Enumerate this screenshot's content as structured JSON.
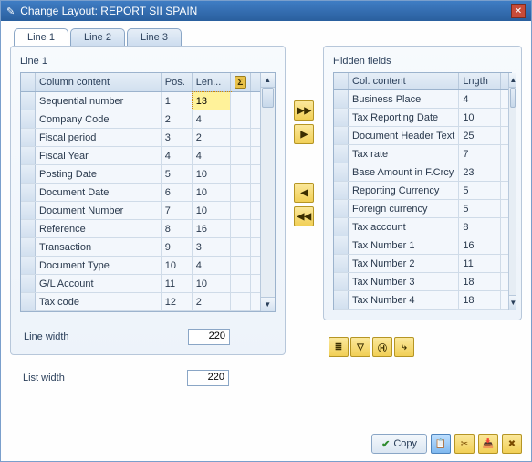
{
  "title": "Change Layout: REPORT SII SPAIN",
  "tabs": [
    "Line 1",
    "Line 2",
    "Line 3"
  ],
  "activeTab": 0,
  "leftPanel": {
    "legend": "Line 1",
    "headers": {
      "content": "Column content",
      "pos": "Pos.",
      "len": "Len..."
    },
    "rows": [
      {
        "content": "Sequential number",
        "pos": "1",
        "len": "13",
        "editing": true
      },
      {
        "content": "Company Code",
        "pos": "2",
        "len": "4"
      },
      {
        "content": "Fiscal period",
        "pos": "3",
        "len": "2"
      },
      {
        "content": "Fiscal Year",
        "pos": "4",
        "len": "4"
      },
      {
        "content": "Posting Date",
        "pos": "5",
        "len": "10"
      },
      {
        "content": "Document Date",
        "pos": "6",
        "len": "10"
      },
      {
        "content": "Document Number",
        "pos": "7",
        "len": "10"
      },
      {
        "content": "Reference",
        "pos": "8",
        "len": "16"
      },
      {
        "content": "Transaction",
        "pos": "9",
        "len": "3"
      },
      {
        "content": "Document Type",
        "pos": "10",
        "len": "4"
      },
      {
        "content": "G/L Account",
        "pos": "11",
        "len": "10"
      },
      {
        "content": "Tax code",
        "pos": "12",
        "len": "2"
      }
    ],
    "lineWidthLabel": "Line width",
    "lineWidth": "220"
  },
  "rightPanel": {
    "legend": "Hidden fields",
    "headers": {
      "content": "Col. content",
      "len": "Lngth"
    },
    "rows": [
      {
        "content": "Business Place",
        "len": "4"
      },
      {
        "content": "Tax Reporting Date",
        "len": "10"
      },
      {
        "content": "Document Header Text",
        "len": "25"
      },
      {
        "content": "Tax rate",
        "len": "7"
      },
      {
        "content": "Base Amount in F.Crcy",
        "len": "23"
      },
      {
        "content": "Reporting Currency",
        "len": "5"
      },
      {
        "content": "Foreign currency",
        "len": "5"
      },
      {
        "content": "Tax account",
        "len": "8"
      },
      {
        "content": "Tax Number 1",
        "len": "16"
      },
      {
        "content": "Tax Number 2",
        "len": "11"
      },
      {
        "content": "Tax Number 3",
        "len": "18"
      },
      {
        "content": "Tax Number 4",
        "len": "18"
      }
    ]
  },
  "listWidthLabel": "List width",
  "listWidth": "220",
  "midButtons": {
    "moveRightAll": "▶▶",
    "moveRight": "▶",
    "moveLeft": "◀",
    "moveLeftAll": "◀◀"
  },
  "footer": {
    "copy": "Copy"
  }
}
